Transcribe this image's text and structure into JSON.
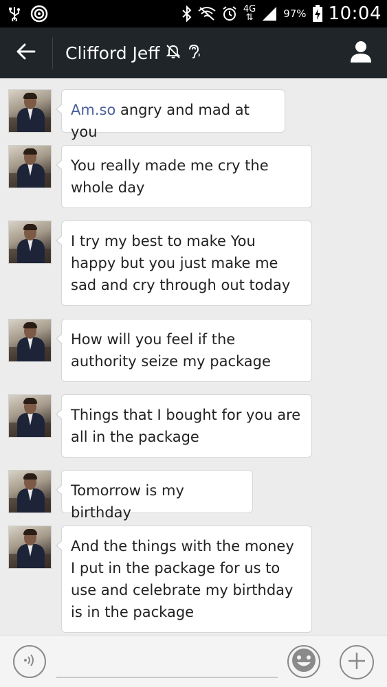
{
  "status_bar": {
    "network_type": "4G",
    "battery_percent": "97%",
    "time": "10:04"
  },
  "header": {
    "title": "Clifford Jeff",
    "icons": [
      "back-arrow-icon",
      "mute-bell-icon",
      "ear-icon",
      "profile-icon"
    ]
  },
  "messages": [
    {
      "sender": "Clifford Jeff",
      "parts": [
        {
          "text": "Am.so",
          "link": true
        },
        {
          "text": " angry and mad at you",
          "link": false
        }
      ]
    },
    {
      "sender": "Clifford Jeff",
      "text": "You really made me cry the whole day"
    },
    {
      "sender": "Clifford Jeff",
      "text": "I try my best to make You happy but you just make me sad and cry through out today"
    },
    {
      "sender": "Clifford Jeff",
      "text": "How will you feel if the authority seize my package"
    },
    {
      "sender": "Clifford Jeff",
      "text": "Things that I bought for you are all in the package"
    },
    {
      "sender": "Clifford Jeff",
      "text": "Tomorrow is my birthday"
    },
    {
      "sender": "Clifford Jeff",
      "text": "And the things with the money I put in the package for us to use and celebrate my birthday is in the package"
    }
  ],
  "input_bar": {
    "placeholder": "",
    "icons": [
      "voice-icon",
      "emoji-icon",
      "plus-icon"
    ]
  }
}
